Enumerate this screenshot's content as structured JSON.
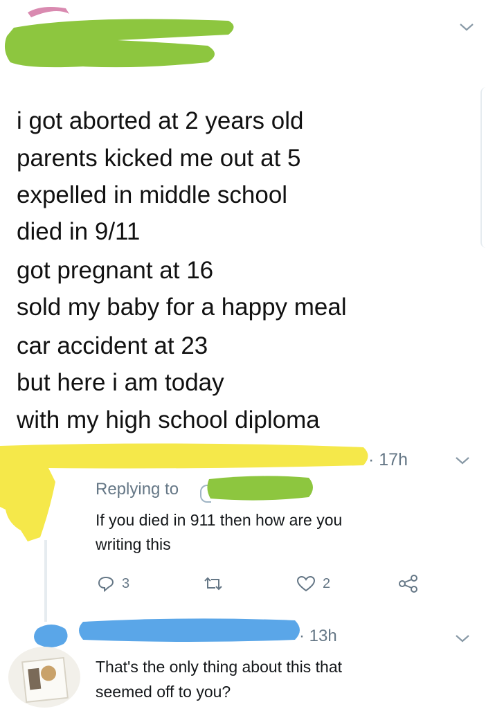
{
  "main_tweet": {
    "lines": [
      "i got aborted at 2 years old",
      "parents kicked me out at 5",
      "expelled in middle school",
      "died in 9/11",
      "got pregnant at 16",
      "sold my baby for a happy meal",
      "car accident at 23",
      "but here i am today",
      "with my high school diploma"
    ]
  },
  "reply1": {
    "time": "· 17h",
    "replying_to": "Replying to",
    "text_line1": "If you died in 911 then how are you",
    "text_line2": "writing this",
    "reply_count": "3",
    "like_count": "2"
  },
  "reply2": {
    "time": "· 13h",
    "text_line1": "That's the only thing about this that",
    "text_line2": "seemed off to you?"
  },
  "colors": {
    "green_redaction": "#8dc63f",
    "yellow_redaction": "#f5e84a",
    "blue_redaction": "#5aa6e8",
    "meta_gray": "#657786"
  },
  "icons": [
    "chevron-down-icon",
    "reply-icon",
    "retweet-icon",
    "like-icon",
    "share-icon"
  ]
}
